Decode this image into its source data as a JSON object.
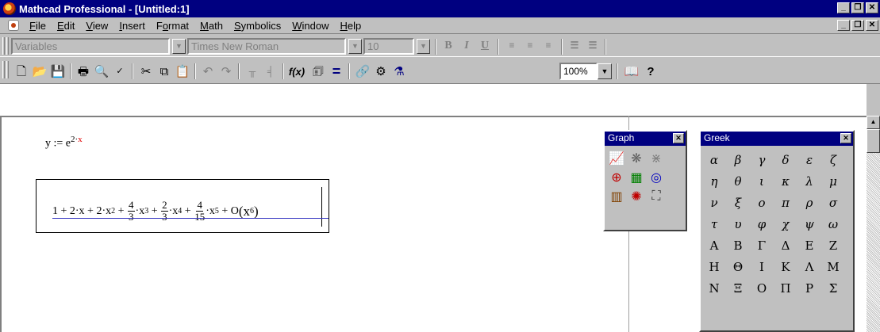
{
  "window": {
    "title": "Mathcad Professional - [Untitled:1]"
  },
  "menu": [
    "File",
    "Edit",
    "View",
    "Insert",
    "Format",
    "Math",
    "Symbolics",
    "Window",
    "Help"
  ],
  "menu_underline": [
    "F",
    "E",
    "V",
    "I",
    "o",
    "M",
    "S",
    "W",
    "H"
  ],
  "format_toolbar": {
    "style": "Variables",
    "font": "Times New Roman",
    "size": "10",
    "bold": "B",
    "italic": "I",
    "underline": "U"
  },
  "standard_toolbar": {
    "zoom": "100%"
  },
  "worksheet": {
    "eq1": {
      "lhs": "y := e",
      "exp_a": "2·",
      "exp_b": "x"
    },
    "series": {
      "t1": "1 + 2·x + 2·x",
      "p2": "2",
      "t2": " + ",
      "f1n": "4",
      "f1d": "3",
      "t3": "·x",
      "p3": "3",
      "t4": " + ",
      "f2n": "2",
      "f2d": "3",
      "t5": "·x",
      "p4": "4",
      "t6": " + ",
      "f3n": "4",
      "f3d": "15",
      "t7": "·x",
      "p5": "5",
      "t8": " + O",
      "t9": "(x",
      "p6": "6",
      "t10": ")"
    }
  },
  "graph_palette": {
    "title": "Graph"
  },
  "greek_palette": {
    "title": "Greek",
    "letters": [
      "α",
      "β",
      "γ",
      "δ",
      "ε",
      "ζ",
      "η",
      "θ",
      "ι",
      "κ",
      "λ",
      "μ",
      "ν",
      "ξ",
      "ο",
      "π",
      "ρ",
      "σ",
      "τ",
      "υ",
      "φ",
      "χ",
      "ψ",
      "ω",
      "Α",
      "Β",
      "Γ",
      "Δ",
      "Ε",
      "Ζ",
      "Η",
      "Θ",
      "Ι",
      "Κ",
      "Λ",
      "Μ",
      "Ν",
      "Ξ",
      "Ο",
      "Π",
      "Ρ",
      "Σ"
    ]
  }
}
